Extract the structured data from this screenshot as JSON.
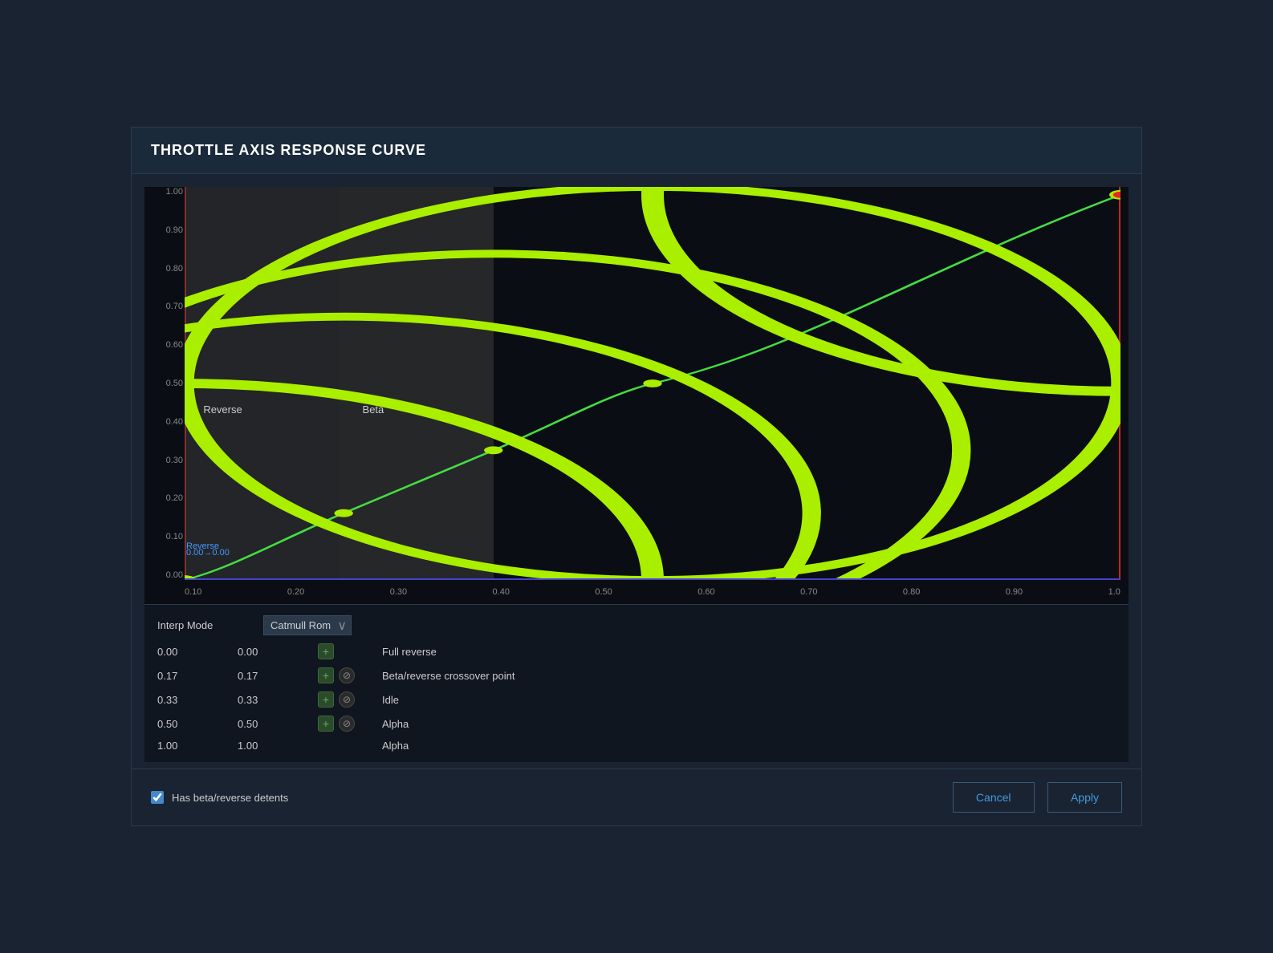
{
  "dialog": {
    "title": "THROTTLE AXIS RESPONSE CURVE"
  },
  "chart": {
    "y_labels": [
      "1.00",
      "0.90",
      "0.80",
      "0.70",
      "0.60",
      "0.50",
      "0.40",
      "0.30",
      "0.20",
      "0.10",
      "0.00"
    ],
    "x_labels": [
      "0.10",
      "0.20",
      "0.30",
      "0.40",
      "0.50",
      "0.60",
      "0.70",
      "0.80",
      "0.90",
      "1.0"
    ],
    "zone_reverse_label": "Reverse",
    "zone_beta_label": "Beta",
    "inline_label_reverse": "Reverse",
    "inline_label_zero": "0.00→0.00",
    "curve_color": "#44dd44",
    "red_line_color": "#cc2222",
    "blue_line_color": "#4444cc"
  },
  "table": {
    "interp_label": "Interp Mode",
    "interp_value": "Catmull Rom",
    "rows": [
      {
        "x": "0.00",
        "y": "0.00",
        "can_add": true,
        "can_remove": false,
        "label": "Full reverse"
      },
      {
        "x": "0.17",
        "y": "0.17",
        "can_add": true,
        "can_remove": true,
        "label": "Beta/reverse crossover point"
      },
      {
        "x": "0.33",
        "y": "0.33",
        "can_add": true,
        "can_remove": true,
        "label": "Idle"
      },
      {
        "x": "0.50",
        "y": "0.50",
        "can_add": true,
        "can_remove": true,
        "label": "Alpha"
      },
      {
        "x": "1.00",
        "y": "1.00",
        "can_add": false,
        "can_remove": false,
        "label": "Alpha"
      }
    ]
  },
  "footer": {
    "checkbox_label": "Has beta/reverse detents",
    "cancel_label": "Cancel",
    "apply_label": "Apply"
  }
}
